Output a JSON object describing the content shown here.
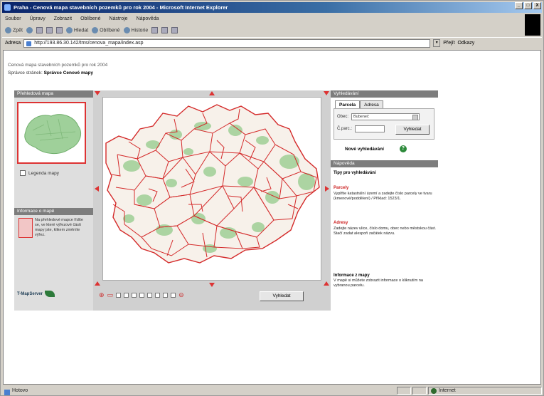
{
  "window": {
    "title": "Praha - Cenová mapa stavebních pozemků pro rok 2004 - Microsoft Internet Explorer",
    "controls": [
      "_",
      "□",
      "X"
    ]
  },
  "menubar": [
    "Soubor",
    "Úpravy",
    "Zobrazit",
    "Oblíbené",
    "Nástroje",
    "Nápověda"
  ],
  "toolbar": {
    "back": "Zpět",
    "search": "Hledat",
    "favorites": "Oblíbené",
    "history": "Historie"
  },
  "addressbar": {
    "label": "Adresa",
    "url": "http://193.86.30.142/tms/cenova_mapa/index.asp",
    "go": "Přejít",
    "links": "Odkazy"
  },
  "page": {
    "title": "Cenová mapa stavebních pozemků pro rok 2004",
    "subtitle_prefix": "Správce stránek:",
    "subtitle_value": "Správce Cenové mapy"
  },
  "left_panel": {
    "overview_header": "Přehledová mapa",
    "legend_checkbox": "Legenda mapy",
    "info_header": "Informace o mapě",
    "info_text": "Na přehledové mapce řídíte se, ve které výřezové části mapy jste, klikem změníte výřez."
  },
  "logo_text": "T-MapServer",
  "zoom_button": "Vyhledat",
  "right_panel": {
    "search_header": "Vyhledávání",
    "tabs": [
      "Parcela",
      "Adresa"
    ],
    "district_label": "Obec:",
    "district_value": "Bubeneč",
    "parcel_label": "Č.parc.:",
    "search_button": "Vyhledat",
    "new_search": "Nové vyhledávání",
    "help_header": "Nápověda",
    "hints_title": "Tipy pro vyhledávání",
    "hints": [
      {
        "title": "Parcely",
        "text": "Vyplňte katastrální území a zadejte číslo parcely ve tvaru (kmenové/poddělení) / Příklad: 1523/1."
      },
      {
        "title": "Adresy",
        "text": "Zadejte název ulice, číslo domu, obec nebo městskou část. Stačí zadat alespoň začátek názvu."
      },
      {
        "title": "Informace z mapy",
        "text": "V mapě si můžete zobrazit informace o kliknutím na vybranou parcelu."
      }
    ]
  },
  "statusbar": {
    "status": "Hotovo",
    "zone": "Internet"
  }
}
